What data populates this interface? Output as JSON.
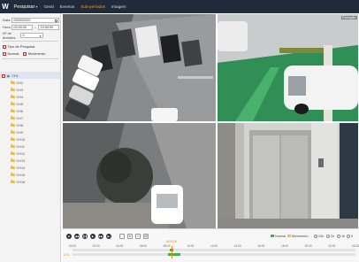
{
  "topbar": {
    "logo": "W",
    "menu": [
      {
        "label": "Pesquisar",
        "active": true,
        "caret": true
      },
      {
        "label": "Geral"
      },
      {
        "label": "Eventos"
      },
      {
        "label": "Sub-períodos",
        "highlight": true
      },
      {
        "label": "Imagem"
      }
    ]
  },
  "search": {
    "date_label": "Data",
    "date_value": "00/00/2020",
    "time_label": "Hora",
    "time_start": "00:00:00",
    "time_end": "23:59:59",
    "division_label": "Nº de divisões",
    "division_value": "4",
    "search_type_label": "Tipo de Pesquisa",
    "normal_label": "Normal",
    "movement_label": "Movimento"
  },
  "channels": [
    "CH1",
    "CH2",
    "CH3",
    "CH4",
    "CH5",
    "CH6",
    "CH7",
    "CH8",
    "CH9",
    "CH10",
    "CH11",
    "CH12",
    "CH13",
    "CH14",
    "CH15",
    "CH16"
  ],
  "cameras": [
    {
      "label": ""
    },
    {
      "label": "Gravação"
    },
    {
      "label": ""
    },
    {
      "label": ""
    }
  ],
  "playback": {
    "legend_normal": "Normal",
    "legend_movement": "Movimento",
    "range_24h": "24h",
    "range_2h": "2h",
    "range_1h": "1h",
    "range_30m": "0",
    "cursor_time": "08:00:00",
    "ticks": [
      "00:00",
      "02:00",
      "04:00",
      "06:00",
      "08:00",
      "10:00",
      "12:00",
      "14:00",
      "16:00",
      "18:00",
      "20:00",
      "22:00",
      "24:00"
    ],
    "side_label": "CH1"
  },
  "colors": {
    "topbar": "#1f2a3b",
    "accent": "#f08a00",
    "record_normal": "#3fb34f",
    "record_movement": "#f1c232"
  }
}
